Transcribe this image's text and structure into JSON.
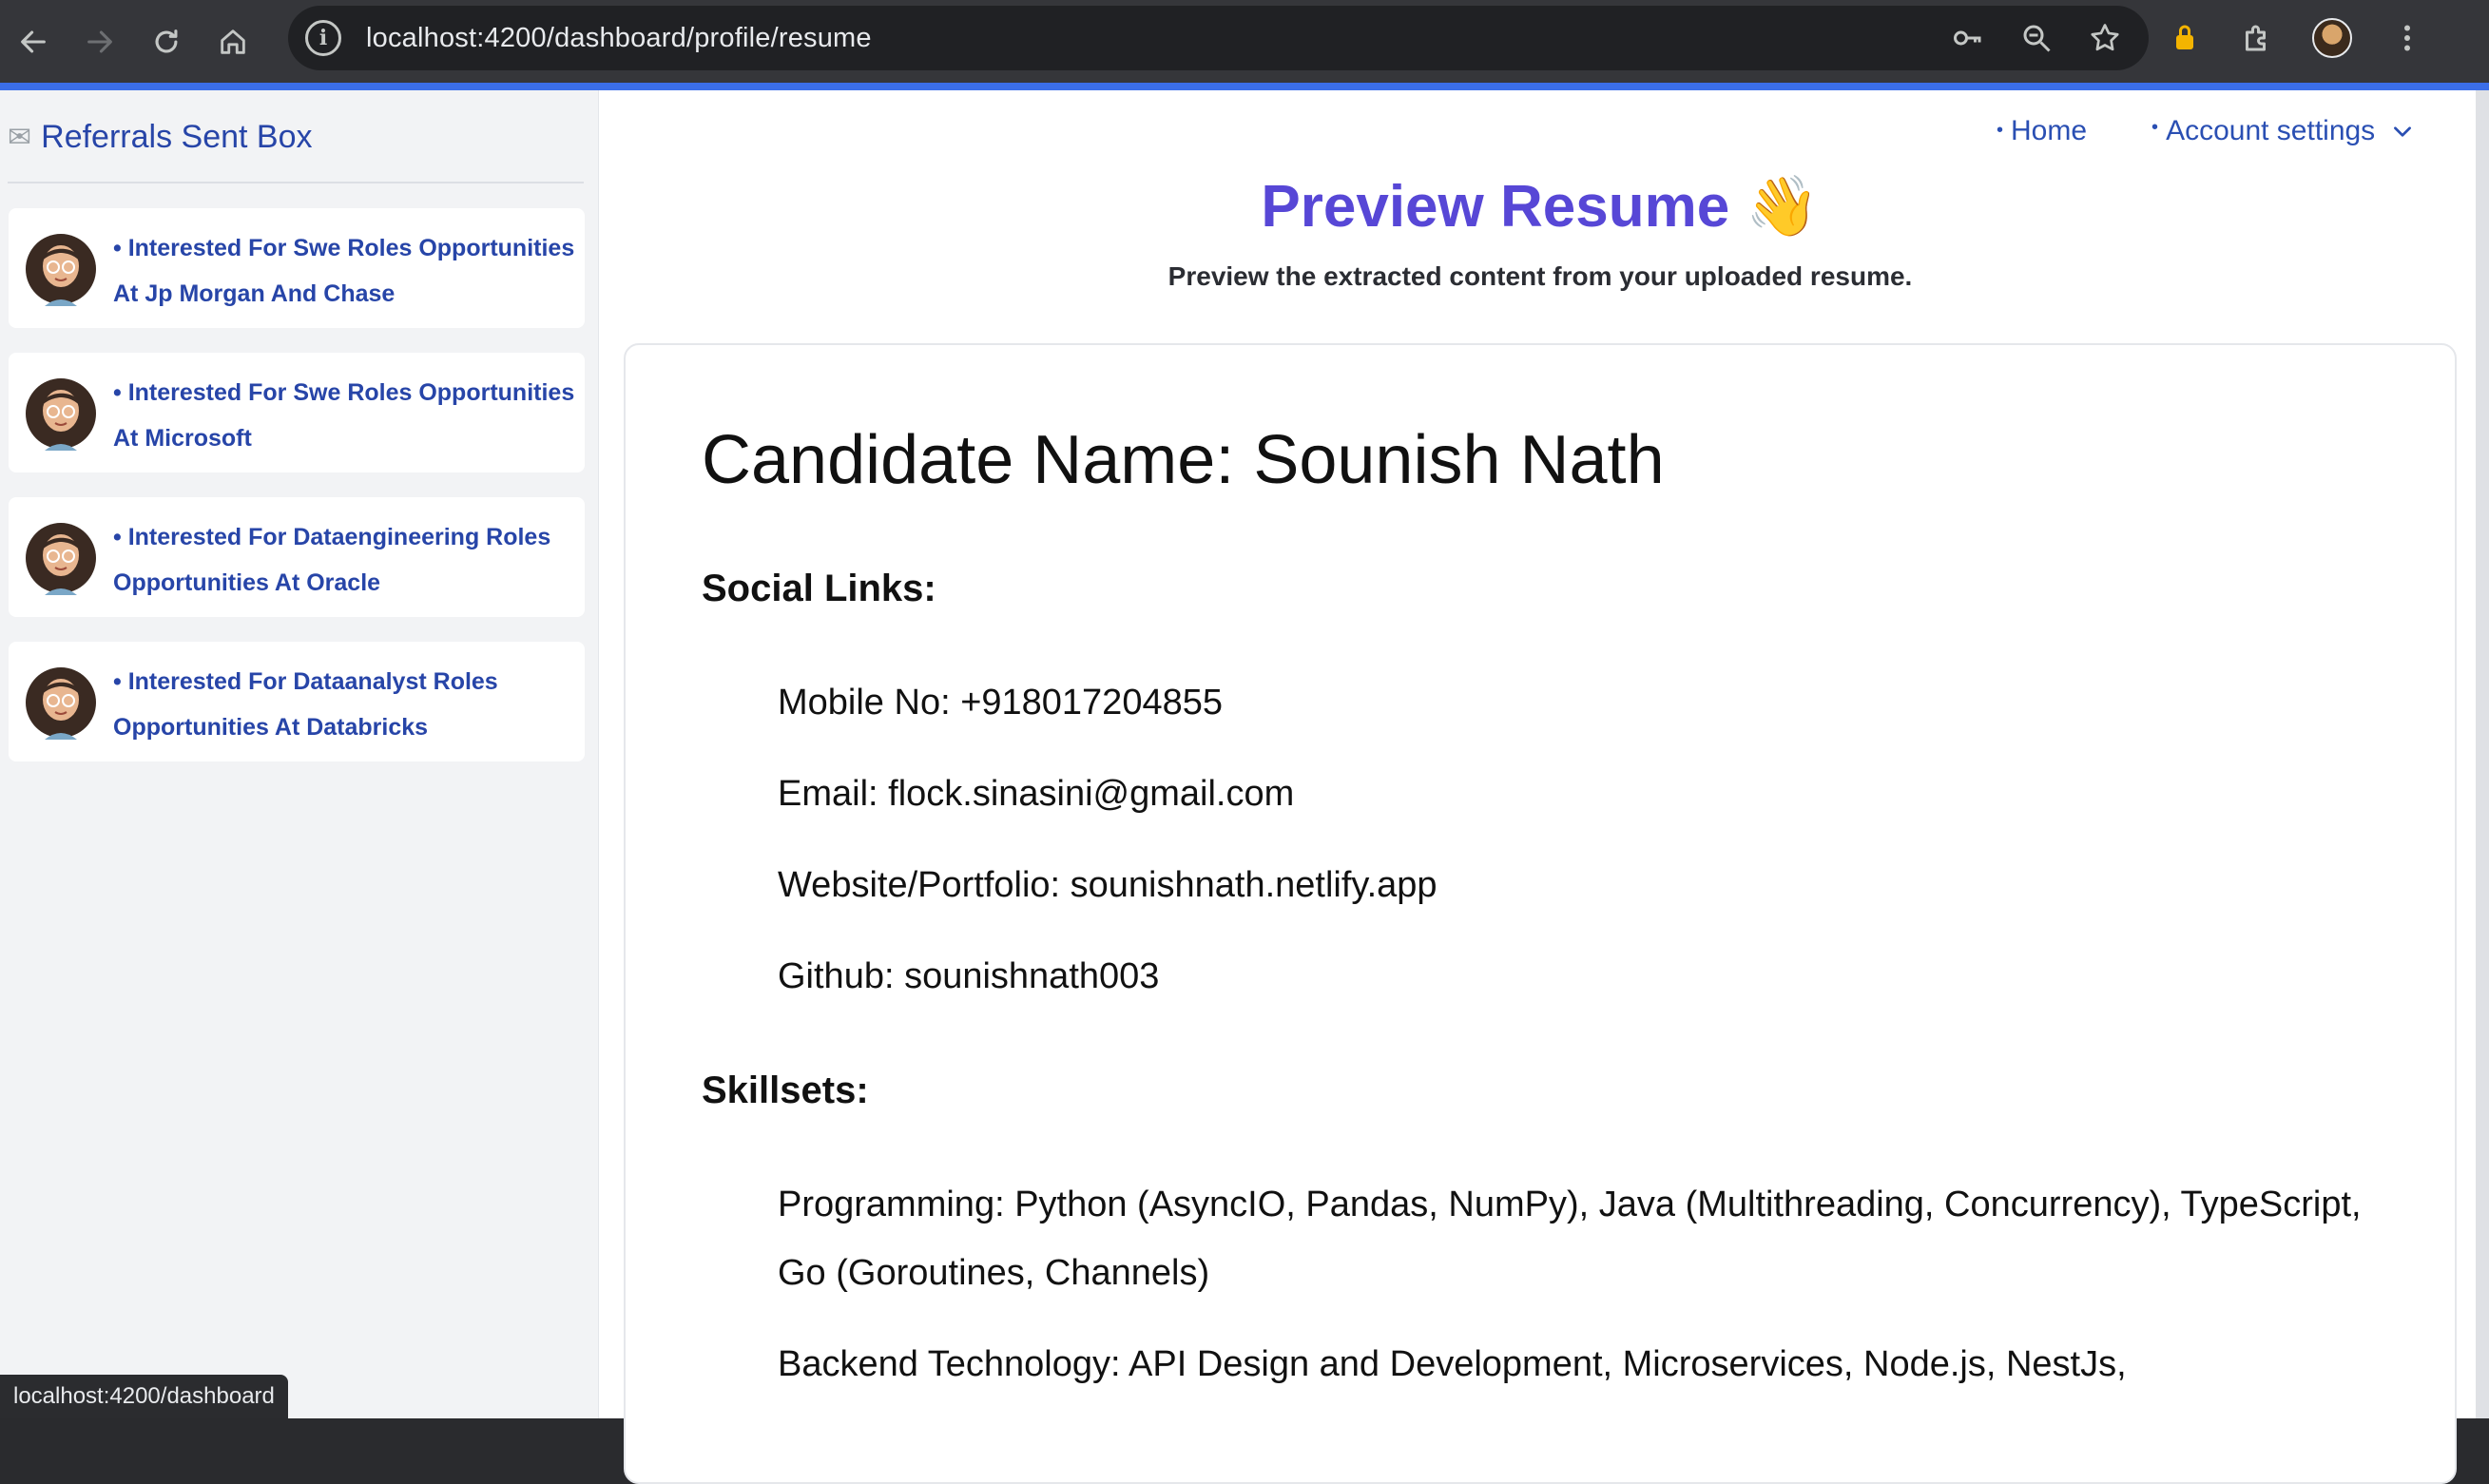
{
  "browser": {
    "url": "localhost:4200/dashboard/profile/resume",
    "status_url": "localhost:4200/dashboard"
  },
  "sidebar": {
    "icon": "envelope-icon",
    "title": "Referrals Sent Box",
    "items": [
      {
        "label": "• Interested For Swe Roles Opportunities At Jp Morgan And Chase"
      },
      {
        "label": "• Interested For Swe Roles Opportunities At Microsoft"
      },
      {
        "label": "• Interested For Dataengineering Roles Opportunities At Oracle"
      },
      {
        "label": "• Interested For Dataanalyst Roles Opportunities At Databricks"
      }
    ]
  },
  "topnav": {
    "home": "Home",
    "account": "Account settings"
  },
  "header": {
    "title": "Preview Resume 👋",
    "subtitle": "Preview the extracted content from your uploaded resume."
  },
  "resume": {
    "candidate": "Candidate Name: Sounish Nath",
    "social_title": "Social Links:",
    "social": [
      "Mobile No: +918017204855",
      "Email: flock.sinasini@gmail.com",
      "Website/Portfolio: sounishnath.netlify.app",
      "Github: sounishnath003"
    ],
    "skills_title": "Skillsets:",
    "skills": [
      "Programming: Python (AsyncIO, Pandas, NumPy), Java (Multithreading, Concurrency), TypeScript, Go (Goroutines, Channels)",
      "Backend Technology: API Design and Development, Microservices, Node.js, NestJs,"
    ]
  },
  "colors": {
    "accent": "#5747d6",
    "link": "#2745a8",
    "chrome": "#35363a",
    "progress": "#3b6ee8"
  }
}
